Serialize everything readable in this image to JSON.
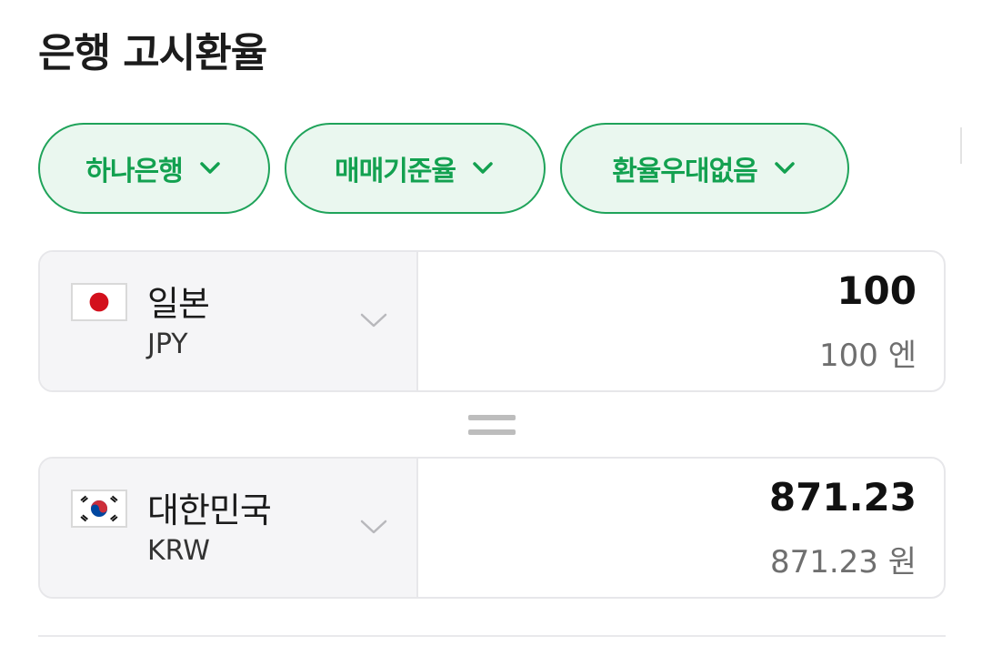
{
  "page": {
    "title": "은행 고시환율"
  },
  "filters": [
    {
      "label": "하나은행",
      "icon": "chevron-down-icon"
    },
    {
      "label": "매매기준율",
      "icon": "chevron-down-icon"
    },
    {
      "label": "환율우대없음",
      "icon": "chevron-down-icon"
    }
  ],
  "converter": {
    "from": {
      "country": "일본",
      "code": "JPY",
      "flag": "japan-flag-icon",
      "amount": "100",
      "amount_text": "100 엔"
    },
    "equals_icon": "equals-icon",
    "to": {
      "country": "대한민국",
      "code": "KRW",
      "flag": "korea-flag-icon",
      "amount": "871.23",
      "amount_text": "871.23 원"
    }
  },
  "colors": {
    "accent_green": "#13a150",
    "chip_bg": "#eaf7ef",
    "pane_bg": "#f5f5f7",
    "japan_red": "#d3101c",
    "korea_red": "#cd2e3a",
    "korea_blue": "#0047a0"
  }
}
